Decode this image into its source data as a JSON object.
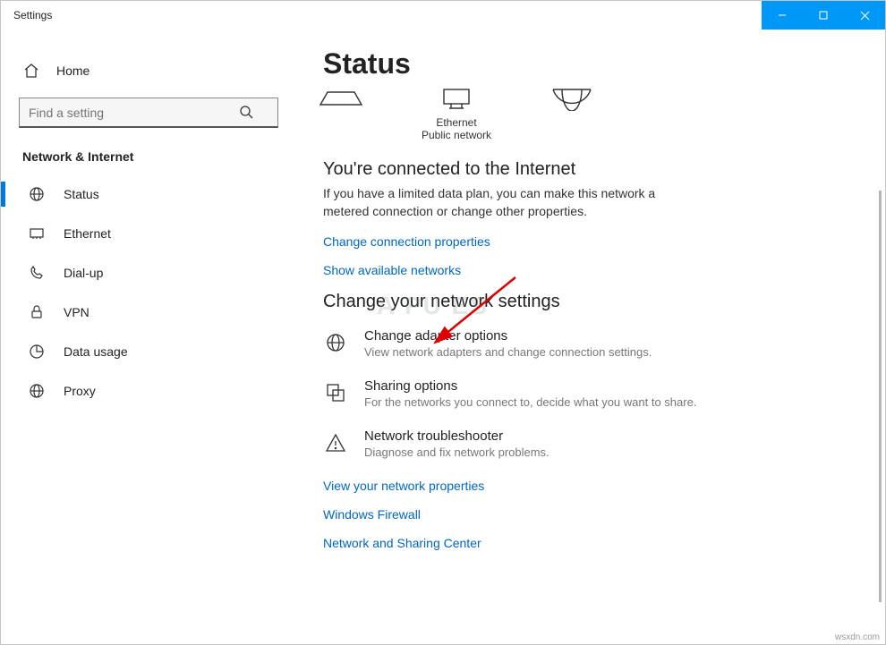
{
  "window": {
    "title": "Settings"
  },
  "sidebar": {
    "home": "Home",
    "search_placeholder": "Find a setting",
    "category": "Network & Internet",
    "items": [
      {
        "label": "Status"
      },
      {
        "label": "Ethernet"
      },
      {
        "label": "Dial-up"
      },
      {
        "label": "VPN"
      },
      {
        "label": "Data usage"
      },
      {
        "label": "Proxy"
      }
    ]
  },
  "main": {
    "heading": "Status",
    "diagram": {
      "ethernet": "Ethernet",
      "public": "Public network"
    },
    "connected_heading": "You're connected to the Internet",
    "connected_desc": "If you have a limited data plan, you can make this network a metered connection or change other properties.",
    "link_change_props": "Change connection properties",
    "link_show_networks": "Show available networks",
    "section_heading": "Change your network settings",
    "adapter": {
      "title": "Change adapter options",
      "sub": "View network adapters and change connection settings."
    },
    "sharing": {
      "title": "Sharing options",
      "sub": "For the networks you connect to, decide what you want to share."
    },
    "troubleshooter": {
      "title": "Network troubleshooter",
      "sub": "Diagnose and fix network problems."
    },
    "link_view_props": "View your network properties",
    "link_firewall": "Windows Firewall",
    "link_sharing_center": "Network and Sharing Center"
  },
  "watermark": "A  PU  ES",
  "credit": "wsxdn.com"
}
